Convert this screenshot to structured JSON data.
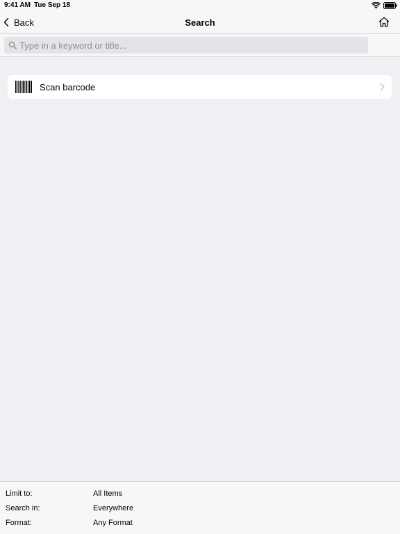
{
  "status_bar": {
    "time": "9:41 AM",
    "date": "Tue Sep 18",
    "wifi_icon": "wifi-icon",
    "battery_icon": "battery-icon"
  },
  "nav": {
    "back_label": "Back",
    "title": "Search",
    "home_icon": "home-icon"
  },
  "search": {
    "placeholder": "Type in a keyword or title...",
    "value": ""
  },
  "scan": {
    "label": "Scan barcode",
    "icon": "barcode-icon"
  },
  "options": [
    {
      "label": "Limit to:",
      "value": "All Items"
    },
    {
      "label": "Search in:",
      "value": "Everywhere"
    },
    {
      "label": "Format:",
      "value": "Any Format"
    }
  ]
}
